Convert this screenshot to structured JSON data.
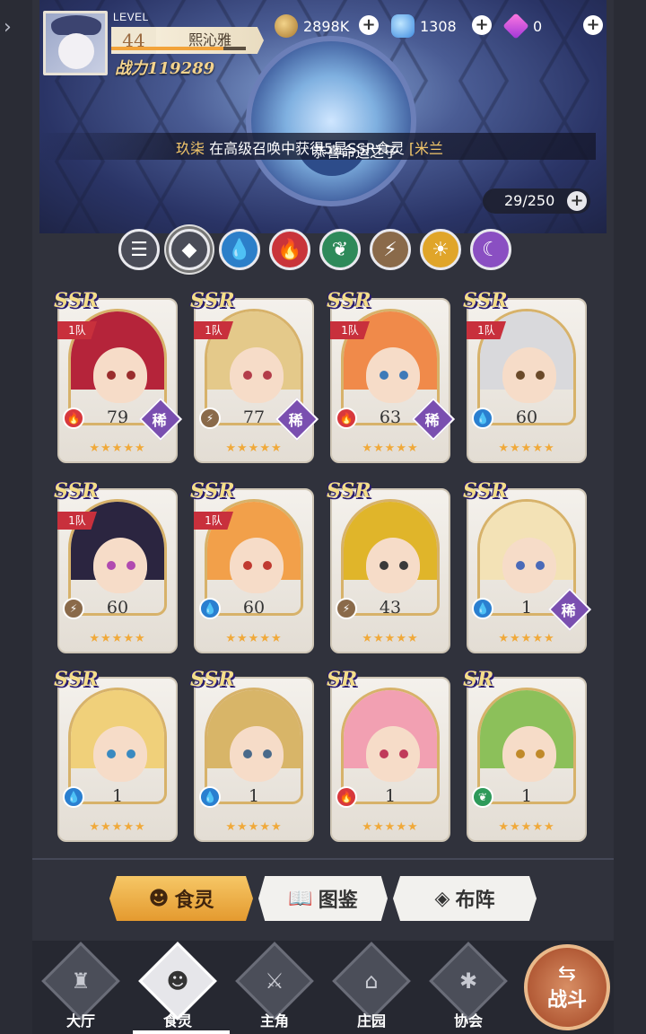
{
  "header": {
    "level_label": "LEVEL",
    "level": "44",
    "player_name": "熙沁雅",
    "xp_fraction": 0.83,
    "power": "战力119289"
  },
  "resources": [
    {
      "icon": "coin-icon",
      "value": "2898K"
    },
    {
      "icon": "gem-icon",
      "value": "1308"
    },
    {
      "icon": "diamond-icon",
      "value": "0"
    }
  ],
  "marquee": {
    "prefix": "恭喜命运之子 ",
    "player": "玖柒",
    "middle": " 在高级召唤中获得5星SSR食灵 ",
    "item": "[米兰"
  },
  "roster_count": "29/250",
  "filters": [
    {
      "name": "filter-all-icon",
      "glyph": "☰",
      "color": "#4a4c58"
    },
    {
      "name": "filter-general-icon",
      "glyph": "◆",
      "color": "#4a4c58",
      "active": true
    },
    {
      "name": "filter-water-icon",
      "glyph": "💧",
      "color": "#2c7fc9"
    },
    {
      "name": "filter-fire-icon",
      "glyph": "🔥",
      "color": "#c9343a"
    },
    {
      "name": "filter-wind-icon",
      "glyph": "❦",
      "color": "#2e8a5a"
    },
    {
      "name": "filter-thunder-icon",
      "glyph": "⚡",
      "color": "#8a6a4a"
    },
    {
      "name": "filter-light-icon",
      "glyph": "☀",
      "color": "#e0a52a"
    },
    {
      "name": "filter-dark-icon",
      "glyph": "☾",
      "color": "#8a4fc2"
    }
  ],
  "cards": [
    {
      "grade": "SSR",
      "team": "1队",
      "element": "fire",
      "level": "79",
      "rare": "稀",
      "stars": "★★★★★",
      "hair": "#b5243a",
      "eye": "#9a2d2d"
    },
    {
      "grade": "SSR",
      "team": "1队",
      "element": "thunder",
      "level": "77",
      "rare": "稀",
      "stars": "★★★★★",
      "hair": "#e4c98a",
      "eye": "#b33d4a"
    },
    {
      "grade": "SSR",
      "team": "1队",
      "element": "fire",
      "level": "63",
      "rare": "稀",
      "stars": "★★★★★",
      "hair": "#f08a4a",
      "eye": "#3e7ab8"
    },
    {
      "grade": "SSR",
      "team": "1队",
      "element": "water",
      "level": "60",
      "rare": "",
      "stars": "★★★★★",
      "hair": "#d9d9dc",
      "eye": "#6a4a2a"
    },
    {
      "grade": "SSR",
      "team": "1队",
      "element": "thunder",
      "level": "60",
      "rare": "",
      "stars": "★★★★★",
      "hair": "#2b2540",
      "eye": "#b04ab0"
    },
    {
      "grade": "SSR",
      "team": "1队",
      "element": "water",
      "level": "60",
      "rare": "",
      "stars": "★★★★★",
      "hair": "#f2a04a",
      "eye": "#c03a30"
    },
    {
      "grade": "SSR",
      "team": "",
      "element": "thunder",
      "level": "43",
      "rare": "",
      "stars": "★★★★★",
      "hair": "#e0b52a",
      "eye": "#3a3a3a"
    },
    {
      "grade": "SSR",
      "team": "",
      "element": "water",
      "level": "1",
      "rare": "稀",
      "stars": "★★★★★",
      "hair": "#f3e2b6",
      "eye": "#4a6ab8"
    },
    {
      "grade": "SSR",
      "team": "",
      "element": "water",
      "level": "1",
      "rare": "",
      "stars": "★★★★★",
      "hair": "#f0d07a",
      "eye": "#3a8ac0"
    },
    {
      "grade": "SSR",
      "team": "",
      "element": "water",
      "level": "1",
      "rare": "",
      "stars": "★★★★★",
      "hair": "#d8b568",
      "eye": "#4a6a8a"
    },
    {
      "grade": "SR",
      "team": "",
      "element": "fire",
      "level": "1",
      "rare": "",
      "stars": "★★★★★",
      "hair": "#f2a0b2",
      "eye": "#c03a5a"
    },
    {
      "grade": "SR",
      "team": "",
      "element": "wind",
      "level": "1",
      "rare": "",
      "stars": "★★★★★",
      "hair": "#8cc05a",
      "eye": "#c08a2a"
    }
  ],
  "element_colors": {
    "fire": "#d8383c",
    "water": "#2a7fd0",
    "thunder": "#8a6a4a",
    "wind": "#2e9a5a"
  },
  "element_glyphs": {
    "fire": "🔥",
    "water": "💧",
    "thunder": "⚡",
    "wind": "❦"
  },
  "tabs": [
    {
      "label": "食灵",
      "icon": "spirit-icon",
      "glyph": "☻",
      "active": true
    },
    {
      "label": "图鉴",
      "icon": "book-icon",
      "glyph": "📖",
      "active": false
    },
    {
      "label": "布阵",
      "icon": "formation-icon",
      "glyph": "◈",
      "active": false
    }
  ],
  "nav": [
    {
      "label": "大厅",
      "icon": "hall-icon",
      "glyph": "♜"
    },
    {
      "label": "食灵",
      "icon": "spirit-nav-icon",
      "glyph": "☻",
      "active": true
    },
    {
      "label": "主角",
      "icon": "hero-icon",
      "glyph": "⚔"
    },
    {
      "label": "庄园",
      "icon": "manor-icon",
      "glyph": "⌂"
    },
    {
      "label": "协会",
      "icon": "guild-icon",
      "glyph": "✱"
    }
  ],
  "battle_label": "战斗"
}
